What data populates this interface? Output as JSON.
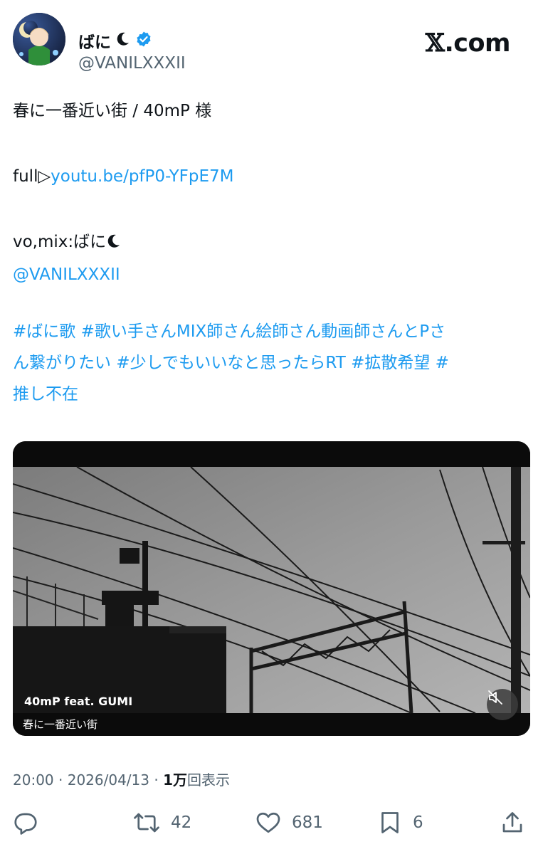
{
  "author": {
    "display_name": "ばに",
    "handle": "@VANILXXXII",
    "verified": true,
    "avatar_icon": "avatar-illustration"
  },
  "site": {
    "logo_mark": "𝕏",
    "logo_text": ".com"
  },
  "tweet": {
    "line1": "春に一番近い街 / 40mP 様",
    "full_prefix": "full▷",
    "full_link": "youtu.be/pfP0-YFpE7M",
    "credit_prefix": "vo,mix:ばに",
    "mention": "@VANILXXXII",
    "hashtags_line1": "#ばに歌 #歌い手さんMIX師さん絵師さん動画師さんとPさ",
    "hashtags_line2": "ん繋がりたい #少しでもいいなと思ったらRT #拡散希望 #",
    "hashtags_line3": "推し不在"
  },
  "media": {
    "caption_artist": "40mP feat. GUMI",
    "caption_title": "春に一番近い街",
    "mute_icon": "speaker-muted-icon"
  },
  "meta": {
    "time": "20:00",
    "separator": "·",
    "date": "2026/04/13",
    "views_count": "1万",
    "views_label": "回表示"
  },
  "actions": {
    "replies": "",
    "reposts": "42",
    "likes": "681",
    "bookmarks": "6"
  },
  "colors": {
    "link": "#1d9bf0",
    "verified": "#1d9bf0",
    "muted_text": "#536471"
  }
}
